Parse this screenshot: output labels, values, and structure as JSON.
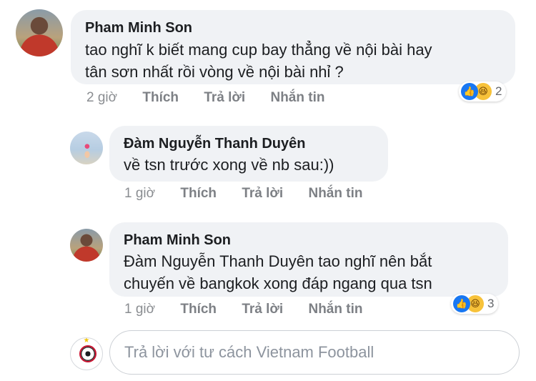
{
  "comments": [
    {
      "author": "Pham Minh Son",
      "lines": [
        "tao nghĩ k biết mang cup bay thẳng về nội bài hay",
        "tân sơn nhất rồi vòng về nội bài nhỉ ?"
      ],
      "time": "2 giờ",
      "like": "Thích",
      "reply": "Trả lời",
      "message": "Nhắn tin",
      "reactions": {
        "like_icon": "like-icon",
        "haha_icon": "haha-icon",
        "count": "2"
      }
    },
    {
      "author": "Đàm Nguyễn Thanh Duyên",
      "lines": [
        "về tsn trước xong về nb sau:))"
      ],
      "time": "1 giờ",
      "like": "Thích",
      "reply": "Trả lời",
      "message": "Nhắn tin"
    },
    {
      "author": "Pham Minh Son",
      "lines": [
        "Đàm Nguyễn Thanh Duyên tao nghĩ nên bắt",
        "chuyến về bangkok xong đáp ngang qua tsn"
      ],
      "time": "1 giờ",
      "like": "Thích",
      "reply": "Trả lời",
      "message": "Nhắn tin",
      "reactions": {
        "like_icon": "like-icon",
        "haha_icon": "haha-icon",
        "count": "3"
      }
    }
  ],
  "reply_box": {
    "placeholder": "Trả lời với tư cách Vietnam Football"
  },
  "colors": {
    "bubble": "#f0f2f5",
    "like_blue": "#1877f2",
    "haha_yellow": "#f7c23a",
    "meta_gray": "#8a8d91"
  }
}
